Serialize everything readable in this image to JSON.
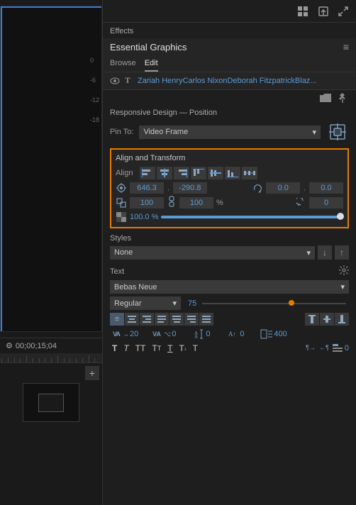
{
  "app": {
    "title": "Essential Graphics"
  },
  "toolbar": {
    "icons": [
      "grid-icon",
      "export-icon",
      "expand-icon"
    ]
  },
  "effects": {
    "label": "Effects",
    "panel_title": "Essential Graphics",
    "menu_icon": "≡",
    "tabs": [
      {
        "label": "Browse",
        "active": false
      },
      {
        "label": "Edit",
        "active": true
      }
    ]
  },
  "text_layer": {
    "text": "Zariah HenryCarlos NixonDeborah FitzpatrickBlaz...",
    "eye_visible": true
  },
  "responsive_design": {
    "label": "Responsive Design — Position",
    "pin_label": "Pin To:",
    "pin_value": "Video Frame"
  },
  "align_transform": {
    "title": "Align and Transform",
    "align_label": "Align",
    "position_x": "646.3",
    "position_y": "-290.8",
    "rotation": "0.0",
    "rotation2": "0.0",
    "scale_w": "100",
    "scale_h": "100",
    "scale_unit": "%",
    "rotation_val": "0",
    "opacity": "100.0 %"
  },
  "styles": {
    "label": "Styles",
    "value": "None"
  },
  "text": {
    "label": "Text",
    "font": "Bebas Neue",
    "style": "Regular",
    "size": "75",
    "align_buttons": [
      "left",
      "center",
      "right",
      "justify-left",
      "justify-center",
      "justify-right",
      "justify-all",
      "top",
      "middle",
      "bottom"
    ],
    "tracking_icon": "VA",
    "tracking_value": "20",
    "kerning_icon": "VA",
    "kerning_value": "0",
    "leading_value": "0",
    "baseline_value": "0",
    "tsumi_value": "400",
    "format_buttons": [
      "T",
      "T",
      "TT",
      "Tt",
      "T̲",
      "T₁",
      "T"
    ],
    "direction_value": "0"
  },
  "timecode": {
    "icon": "⚙",
    "value": "00;00;15;04"
  },
  "side_numbers": [
    "0",
    "-6",
    "-12",
    "-18"
  ]
}
